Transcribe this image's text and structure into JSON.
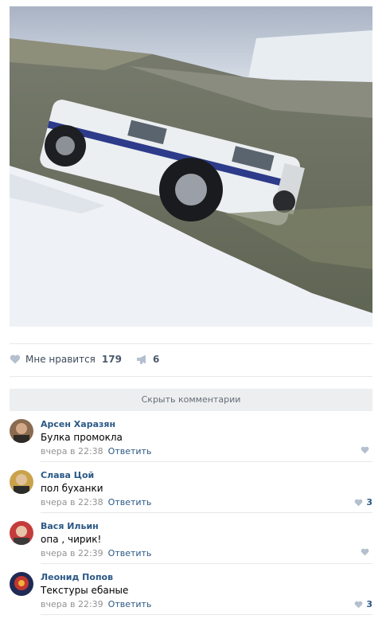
{
  "post": {
    "likes_label": "Мне нравится",
    "likes_count": "179",
    "shares_count": "6"
  },
  "comments_toggle": "Скрыть комментарии",
  "comments": [
    {
      "author": "Арсен Харазян",
      "text": "Булка промокла",
      "time": "вчера в 22:38",
      "reply": "Ответить",
      "likes": ""
    },
    {
      "author": "Слава Цой",
      "text": "пол буханки",
      "time": "вчера в 22:38",
      "reply": "Ответить",
      "likes": "3"
    },
    {
      "author": "Вася Ильин",
      "text": "опа , чирик!",
      "time": "вчера в 22:39",
      "reply": "Ответить",
      "likes": ""
    },
    {
      "author": "Леонид Попов",
      "text": "Текстуры ебаные",
      "time": "вчера в 22:39",
      "reply": "Ответить",
      "likes": "3"
    }
  ],
  "colors": {
    "link": "#2a5885",
    "meta": "#939393",
    "separator": "#e7e8ec",
    "toggle_bg": "#edeef0"
  },
  "icons": {
    "like": "heart-icon",
    "share": "megaphone-icon"
  }
}
